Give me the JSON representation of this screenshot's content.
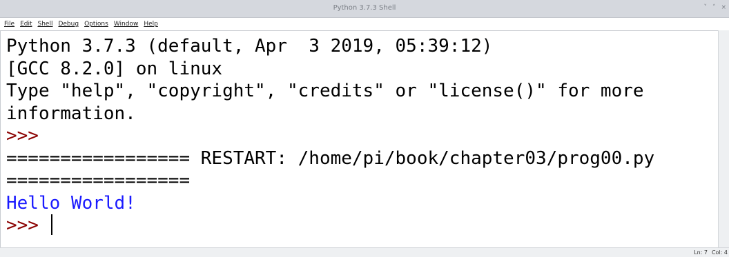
{
  "window": {
    "title": "Python 3.7.3 Shell",
    "controls": [
      "˅",
      "˄",
      "×"
    ]
  },
  "menu": [
    "File",
    "Edit",
    "Shell",
    "Debug",
    "Options",
    "Window",
    "Help"
  ],
  "shell": {
    "banner_line1": "Python 3.7.3 (default, Apr  3 2019, 05:39:12)",
    "banner_line2": "[GCC 8.2.0] on linux",
    "banner_line3": "Type \"help\", \"copyright\", \"credits\" or \"license()\" for more",
    "banner_line4": "information.",
    "prompt": ">>>",
    "restart_line": "================= RESTART: /home/pi/book/chapter03/prog00.py",
    "restart_line2": "=================",
    "output": "Hello World!",
    "prompt2": ">>> "
  },
  "status": {
    "line": "Ln: 7",
    "col": "Col: 4"
  },
  "colors": {
    "prompt": "#8b0000",
    "stdout": "#1a1aff",
    "text": "#000000"
  }
}
